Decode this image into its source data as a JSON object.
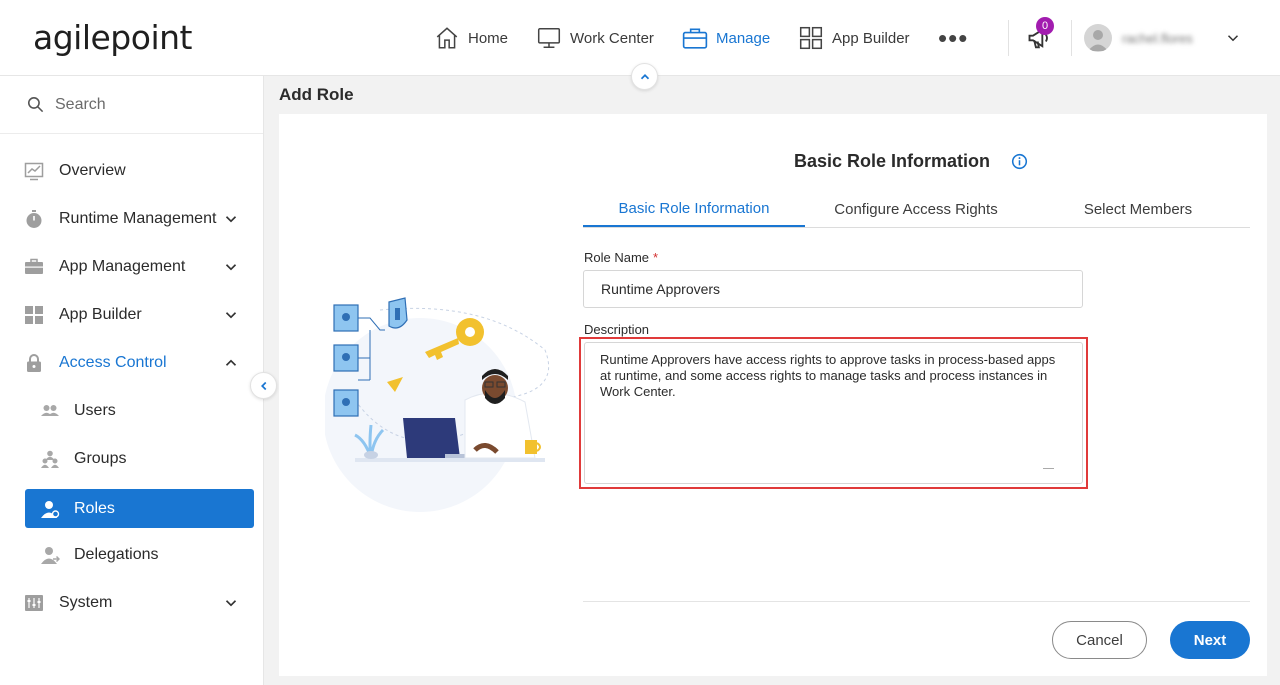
{
  "header": {
    "logo_text": "agilepoint",
    "nav": [
      {
        "label": "Home",
        "icon": "home-icon"
      },
      {
        "label": "Work Center",
        "icon": "monitor-icon"
      },
      {
        "label": "Manage",
        "icon": "briefcase-icon",
        "active": true
      },
      {
        "label": "App Builder",
        "icon": "grid-icon"
      }
    ],
    "more_label": "•••",
    "notification_count": "0",
    "username": "rachel.flores"
  },
  "sidebar": {
    "search_placeholder": "Search",
    "items": [
      {
        "label": "Overview",
        "icon": "chart-icon"
      },
      {
        "label": "Runtime Management",
        "icon": "stopwatch-icon"
      },
      {
        "label": "App Management",
        "icon": "toolbox-icon"
      },
      {
        "label": "App Builder",
        "icon": "grid-icon"
      },
      {
        "label": "Access Control",
        "icon": "lock-icon"
      },
      {
        "label": "Users",
        "icon": "users-icon"
      },
      {
        "label": "Groups",
        "icon": "groups-icon"
      },
      {
        "label": "Roles",
        "icon": "role-icon"
      },
      {
        "label": "Delegations",
        "icon": "delegation-icon"
      },
      {
        "label": "System",
        "icon": "sliders-icon"
      }
    ]
  },
  "main": {
    "page_title": "Add Role",
    "card_title": "Basic Role Information",
    "tabs": [
      {
        "label": "Basic Role Information"
      },
      {
        "label": "Configure Access Rights"
      },
      {
        "label": "Select Members"
      }
    ],
    "role_name_label": "Role Name",
    "required_marker": "*",
    "role_name_value": "Runtime Approvers",
    "description_label": "Description",
    "description_value": "Runtime Approvers have access rights to approve tasks in process-based apps at runtime, and some access rights to manage tasks and process instances in Work Center.",
    "cancel_label": "Cancel",
    "next_label": "Next"
  },
  "colors": {
    "accent": "#1976d2",
    "highlight": "#e03a3a",
    "badge": "#a21caf"
  }
}
